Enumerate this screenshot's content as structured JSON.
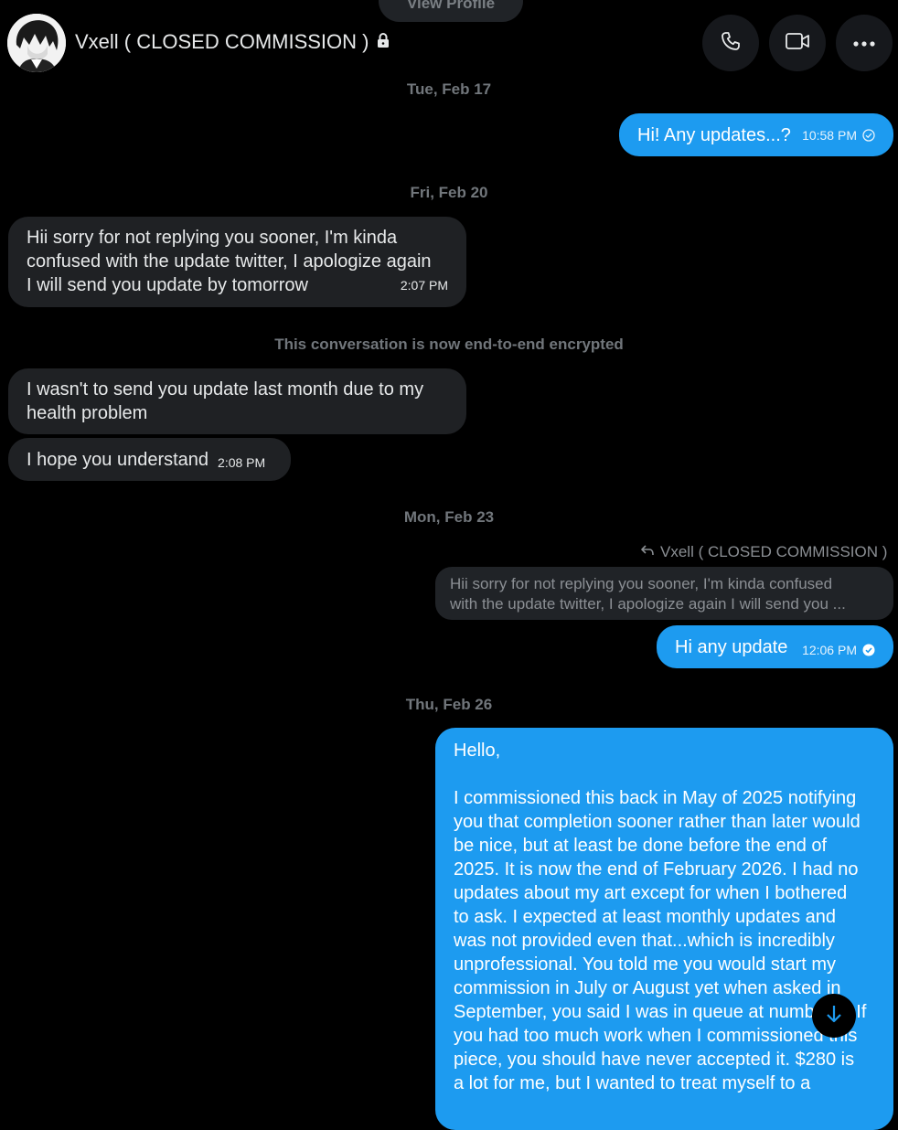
{
  "header": {
    "view_profile_label": "View Profile",
    "chat_title": "Vxell ( CLOSED COMMISSION )",
    "lock_icon": "lock-icon",
    "call_icon": "phone-icon",
    "video_icon": "video-icon",
    "more_icon": "more-icon"
  },
  "conversation": {
    "date_1": "Tue, Feb 17",
    "msg_1_text": "Hi! Any updates...?",
    "msg_1_time": "10:58 PM",
    "date_2": "Fri, Feb 20",
    "msg_2_lines": [
      "Hii sorry for not replying you sooner, I'm kinda",
      "confused with the update twitter, I apologize again",
      "I will send you update by tomorrow"
    ],
    "msg_2_time": "2:07 PM",
    "encrypted_notice": "This conversation is now end-to-end encrypted",
    "msg_3_lines": [
      "I wasn't to send you update last month due to my",
      "health problem"
    ],
    "msg_4_text": "I hope you understand",
    "msg_4_time": "2:08 PM",
    "date_3": "Mon, Feb 23",
    "reply_header": "Vxell ( CLOSED COMMISSION )",
    "reply_quote_lines": [
      "Hii sorry for not replying you sooner, I'm kinda confused",
      "with the update twitter, I apologize again I will send you ..."
    ],
    "msg_5_text": "Hi any update",
    "msg_5_time": "12:06 PM",
    "date_4": "Thu, Feb 26",
    "msg_6_greeting": "Hello,",
    "msg_6_lines": [
      "I commissioned this back in May of 2025 notifying",
      "you that completion sooner rather than later would",
      "be nice, but at least be done before the end of",
      "2025. It is now the end of February 2026. I had no",
      "updates about my art except for when I bothered",
      "to ask. I expected at least monthly updates and",
      "was not provided even that...which is incredibly",
      "unprofessional. You told me you would start my",
      "commission in July or August yet when asked in",
      "September, you said I was in queue at number 8. If",
      "you had too much work when I commissioned this",
      "piece, you should have never accepted it. $280 is",
      "a lot for me, but I wanted to treat myself to a"
    ]
  },
  "colors": {
    "accent": "#1d9bf0",
    "incoming_bubble": "#1f2124",
    "background": "#000000"
  }
}
